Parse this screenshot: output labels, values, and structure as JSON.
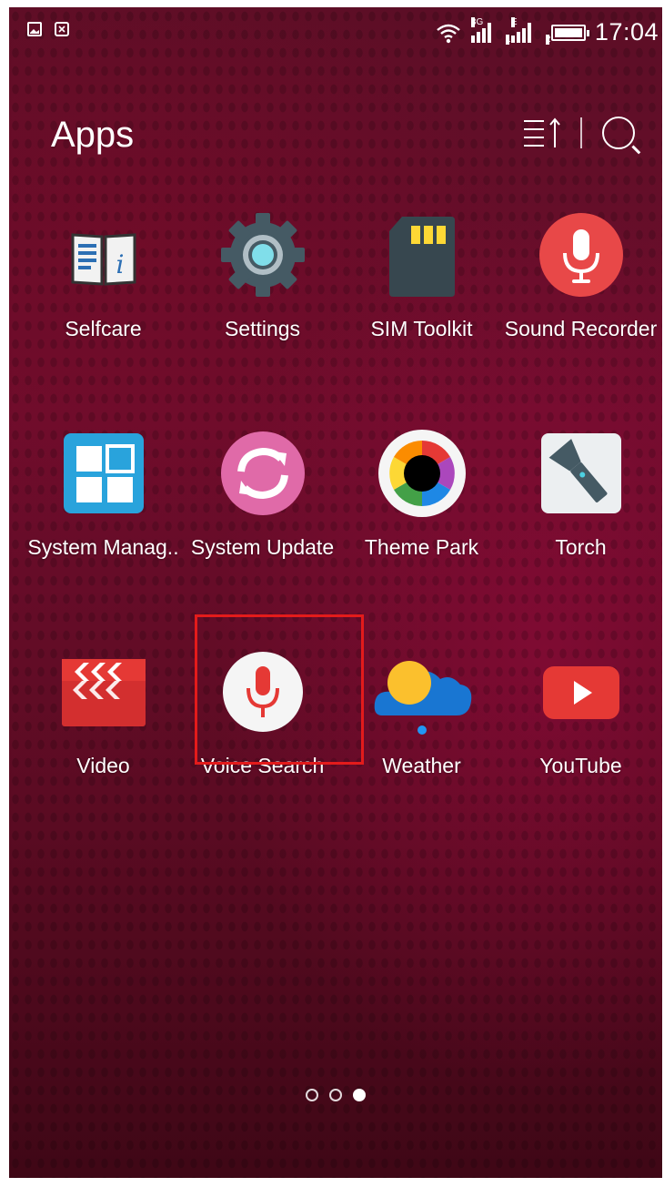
{
  "status_bar": {
    "time": "17:04",
    "network_1": "3G",
    "network_2": "E",
    "sim_1": "1",
    "sim_2": "2",
    "icons": [
      "image-notification-icon",
      "sim-blocked-icon",
      "wifi-icon",
      "signal-icon",
      "signal-icon",
      "battery-icon"
    ]
  },
  "header": {
    "title": "Apps",
    "icons": [
      "sort-icon",
      "search-icon"
    ]
  },
  "apps": [
    {
      "label": "Selfcare",
      "icon": "selfcare-book-icon"
    },
    {
      "label": "Settings",
      "icon": "settings-gear-icon"
    },
    {
      "label": "SIM Toolkit",
      "icon": "sim-card-icon"
    },
    {
      "label": "Sound Recorder",
      "icon": "microphone-icon"
    },
    {
      "label": "System Manag..",
      "icon": "system-manager-icon"
    },
    {
      "label": "System Update",
      "icon": "system-update-sync-icon",
      "highlighted": true
    },
    {
      "label": "Theme Park",
      "icon": "theme-park-icon"
    },
    {
      "label": "Torch",
      "icon": "torch-flashlight-icon"
    },
    {
      "label": "Video",
      "icon": "video-clapper-icon"
    },
    {
      "label": "Voice Search",
      "icon": "voice-search-mic-icon"
    },
    {
      "label": "Weather",
      "icon": "weather-sun-cloud-icon"
    },
    {
      "label": "YouTube",
      "icon": "youtube-play-icon"
    }
  ],
  "page_indicator": {
    "pages": 3,
    "current": 3
  },
  "colors": {
    "highlight_border": "#e31b1b",
    "background": "#5c0e26"
  }
}
